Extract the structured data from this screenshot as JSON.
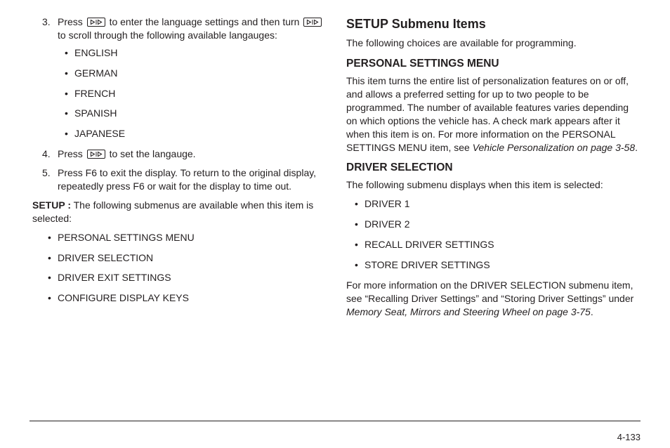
{
  "pageNumber": "4-133",
  "left": {
    "steps": [
      {
        "num": "3.",
        "pre": "Press ",
        "mid": " to enter the language settings and then turn ",
        "post": " to scroll through the following available langauges:",
        "langs": [
          "ENGLISH",
          "GERMAN",
          "FRENCH",
          "SPANISH",
          "JAPANESE"
        ]
      },
      {
        "num": "4.",
        "pre": "Press ",
        "post": " to set the langauge."
      },
      {
        "num": "5.",
        "text": "Press F6 to exit the display. To return to the original display, repeatedly press F6 or wait for the display to time out."
      }
    ],
    "setupLabel": "SETUP :",
    "setupText": "  The following submenus are available when this item is selected:",
    "submenus": [
      "PERSONAL SETTINGS MENU",
      "DRIVER SELECTION",
      "DRIVER EXIT SETTINGS",
      "CONFIGURE DISPLAY KEYS"
    ]
  },
  "right": {
    "mainHeading": "SETUP Submenu Items",
    "intro": "The following choices are available for programming.",
    "personal": {
      "heading": "PERSONAL SETTINGS MENU",
      "body": "This item turns the entire list of personalization features on or off, and allows a preferred setting for up to two people to be programmed. The number of available features varies depending on which options the vehicle has. A check mark appears after it when this item is on. For more information on the PERSONAL SETTINGS MENU item, see ",
      "ref": "Vehicle Personalization on page 3-58",
      "tail": "."
    },
    "driver": {
      "heading": "DRIVER SELECTION",
      "intro": "The following submenu displays when this item is selected:",
      "items": [
        "DRIVER 1",
        "DRIVER 2",
        "RECALL DRIVER SETTINGS",
        "STORE DRIVER SETTINGS"
      ],
      "body": "For more information on the DRIVER SELECTION submenu item, see “Recalling Driver Settings” and “Storing Driver Settings” under ",
      "ref": "Memory Seat, Mirrors and Steering Wheel on page 3-75",
      "tail": "."
    }
  }
}
